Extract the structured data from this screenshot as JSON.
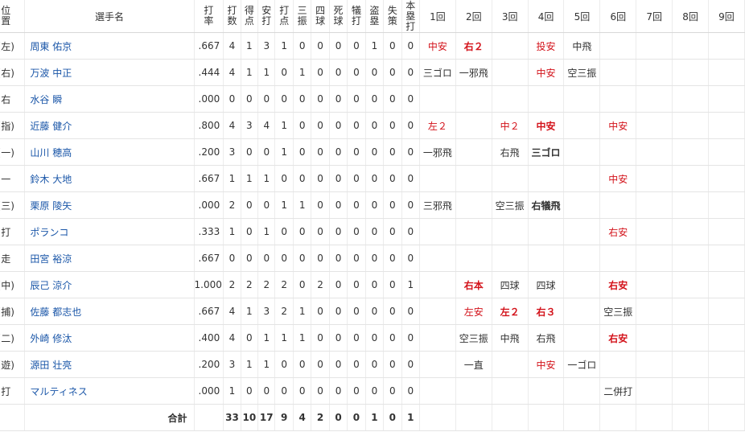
{
  "headers": {
    "position": "位置",
    "player": "選手名",
    "avg": "打率",
    "stats": [
      "打数",
      "得点",
      "安打",
      "打点",
      "三振",
      "四球",
      "死球",
      "犠打",
      "盗塁",
      "失策",
      "本塁打"
    ],
    "innings": [
      "1回",
      "2回",
      "3回",
      "4回",
      "5回",
      "6回",
      "7回",
      "8回",
      "9回"
    ]
  },
  "rows": [
    {
      "pos": "(左)",
      "name": "周東 佑京",
      "avg": ".667",
      "stats": [
        "4",
        "1",
        "3",
        "1",
        "0",
        "0",
        "0",
        "0",
        "1",
        "0",
        "0"
      ],
      "innings": [
        {
          "t": "中安",
          "hit": true,
          "bold": false
        },
        {
          "t": "右２",
          "hit": true,
          "bold": true
        },
        {
          "t": "",
          "hit": false,
          "bold": false
        },
        {
          "t": "投安",
          "hit": true,
          "bold": false
        },
        {
          "t": "中飛",
          "hit": false,
          "bold": false
        },
        {
          "t": "",
          "hit": false,
          "bold": false
        },
        {
          "t": "",
          "hit": false,
          "bold": false
        },
        {
          "t": "",
          "hit": false,
          "bold": false
        },
        {
          "t": "",
          "hit": false,
          "bold": false
        }
      ]
    },
    {
      "pos": "(右)",
      "name": "万波 中正",
      "avg": ".444",
      "stats": [
        "4",
        "1",
        "1",
        "0",
        "1",
        "0",
        "0",
        "0",
        "0",
        "0",
        "0"
      ],
      "innings": [
        {
          "t": "三ゴロ",
          "hit": false,
          "bold": false
        },
        {
          "t": "一邪飛",
          "hit": false,
          "bold": false
        },
        {
          "t": "",
          "hit": false,
          "bold": false
        },
        {
          "t": "中安",
          "hit": true,
          "bold": false
        },
        {
          "t": "空三振",
          "hit": false,
          "bold": false
        },
        {
          "t": "",
          "hit": false,
          "bold": false
        },
        {
          "t": "",
          "hit": false,
          "bold": false
        },
        {
          "t": "",
          "hit": false,
          "bold": false
        },
        {
          "t": "",
          "hit": false,
          "bold": false
        }
      ]
    },
    {
      "pos": "右",
      "name": "水谷 瞬",
      "avg": ".000",
      "stats": [
        "0",
        "0",
        "0",
        "0",
        "0",
        "0",
        "0",
        "0",
        "0",
        "0",
        "0"
      ],
      "innings": [
        {
          "t": "",
          "hit": false,
          "bold": false
        },
        {
          "t": "",
          "hit": false,
          "bold": false
        },
        {
          "t": "",
          "hit": false,
          "bold": false
        },
        {
          "t": "",
          "hit": false,
          "bold": false
        },
        {
          "t": "",
          "hit": false,
          "bold": false
        },
        {
          "t": "",
          "hit": false,
          "bold": false
        },
        {
          "t": "",
          "hit": false,
          "bold": false
        },
        {
          "t": "",
          "hit": false,
          "bold": false
        },
        {
          "t": "",
          "hit": false,
          "bold": false
        }
      ]
    },
    {
      "pos": "(指)",
      "name": "近藤 健介",
      "avg": ".800",
      "stats": [
        "4",
        "3",
        "4",
        "1",
        "0",
        "0",
        "0",
        "0",
        "0",
        "0",
        "0"
      ],
      "innings": [
        {
          "t": "左２",
          "hit": true,
          "bold": false
        },
        {
          "t": "",
          "hit": false,
          "bold": false
        },
        {
          "t": "中２",
          "hit": true,
          "bold": false
        },
        {
          "t": "中安",
          "hit": true,
          "bold": true
        },
        {
          "t": "",
          "hit": false,
          "bold": false
        },
        {
          "t": "中安",
          "hit": true,
          "bold": false
        },
        {
          "t": "",
          "hit": false,
          "bold": false
        },
        {
          "t": "",
          "hit": false,
          "bold": false
        },
        {
          "t": "",
          "hit": false,
          "bold": false
        }
      ]
    },
    {
      "pos": "(一)",
      "name": "山川 穂高",
      "avg": ".200",
      "stats": [
        "3",
        "0",
        "0",
        "1",
        "0",
        "0",
        "0",
        "0",
        "0",
        "0",
        "0"
      ],
      "innings": [
        {
          "t": "一邪飛",
          "hit": false,
          "bold": false
        },
        {
          "t": "",
          "hit": false,
          "bold": false
        },
        {
          "t": "右飛",
          "hit": false,
          "bold": false
        },
        {
          "t": "三ゴロ",
          "hit": false,
          "bold": true
        },
        {
          "t": "",
          "hit": false,
          "bold": false
        },
        {
          "t": "",
          "hit": false,
          "bold": false
        },
        {
          "t": "",
          "hit": false,
          "bold": false
        },
        {
          "t": "",
          "hit": false,
          "bold": false
        },
        {
          "t": "",
          "hit": false,
          "bold": false
        }
      ]
    },
    {
      "pos": "一",
      "name": "鈴木 大地",
      "avg": ".667",
      "stats": [
        "1",
        "1",
        "1",
        "0",
        "0",
        "0",
        "0",
        "0",
        "0",
        "0",
        "0"
      ],
      "innings": [
        {
          "t": "",
          "hit": false,
          "bold": false
        },
        {
          "t": "",
          "hit": false,
          "bold": false
        },
        {
          "t": "",
          "hit": false,
          "bold": false
        },
        {
          "t": "",
          "hit": false,
          "bold": false
        },
        {
          "t": "",
          "hit": false,
          "bold": false
        },
        {
          "t": "中安",
          "hit": true,
          "bold": false
        },
        {
          "t": "",
          "hit": false,
          "bold": false
        },
        {
          "t": "",
          "hit": false,
          "bold": false
        },
        {
          "t": "",
          "hit": false,
          "bold": false
        }
      ]
    },
    {
      "pos": "(三)",
      "name": "栗原 陵矢",
      "avg": ".000",
      "stats": [
        "2",
        "0",
        "0",
        "1",
        "1",
        "0",
        "0",
        "0",
        "0",
        "0",
        "0"
      ],
      "innings": [
        {
          "t": "三邪飛",
          "hit": false,
          "bold": false
        },
        {
          "t": "",
          "hit": false,
          "bold": false
        },
        {
          "t": "空三振",
          "hit": false,
          "bold": false
        },
        {
          "t": "右犠飛",
          "hit": false,
          "bold": true
        },
        {
          "t": "",
          "hit": false,
          "bold": false
        },
        {
          "t": "",
          "hit": false,
          "bold": false
        },
        {
          "t": "",
          "hit": false,
          "bold": false
        },
        {
          "t": "",
          "hit": false,
          "bold": false
        },
        {
          "t": "",
          "hit": false,
          "bold": false
        }
      ]
    },
    {
      "pos": "打",
      "name": "ポランコ",
      "avg": ".333",
      "stats": [
        "1",
        "0",
        "1",
        "0",
        "0",
        "0",
        "0",
        "0",
        "0",
        "0",
        "0"
      ],
      "innings": [
        {
          "t": "",
          "hit": false,
          "bold": false
        },
        {
          "t": "",
          "hit": false,
          "bold": false
        },
        {
          "t": "",
          "hit": false,
          "bold": false
        },
        {
          "t": "",
          "hit": false,
          "bold": false
        },
        {
          "t": "",
          "hit": false,
          "bold": false
        },
        {
          "t": "右安",
          "hit": true,
          "bold": false
        },
        {
          "t": "",
          "hit": false,
          "bold": false
        },
        {
          "t": "",
          "hit": false,
          "bold": false
        },
        {
          "t": "",
          "hit": false,
          "bold": false
        }
      ]
    },
    {
      "pos": "走",
      "name": "田宮 裕涼",
      "avg": ".667",
      "stats": [
        "0",
        "0",
        "0",
        "0",
        "0",
        "0",
        "0",
        "0",
        "0",
        "0",
        "0"
      ],
      "innings": [
        {
          "t": "",
          "hit": false,
          "bold": false
        },
        {
          "t": "",
          "hit": false,
          "bold": false
        },
        {
          "t": "",
          "hit": false,
          "bold": false
        },
        {
          "t": "",
          "hit": false,
          "bold": false
        },
        {
          "t": "",
          "hit": false,
          "bold": false
        },
        {
          "t": "",
          "hit": false,
          "bold": false
        },
        {
          "t": "",
          "hit": false,
          "bold": false
        },
        {
          "t": "",
          "hit": false,
          "bold": false
        },
        {
          "t": "",
          "hit": false,
          "bold": false
        }
      ]
    },
    {
      "pos": "(中)",
      "name": "辰己 涼介",
      "avg": "1.000",
      "stats": [
        "2",
        "2",
        "2",
        "2",
        "0",
        "2",
        "0",
        "0",
        "0",
        "0",
        "1"
      ],
      "innings": [
        {
          "t": "",
          "hit": false,
          "bold": false
        },
        {
          "t": "右本",
          "hit": true,
          "bold": true
        },
        {
          "t": "四球",
          "hit": false,
          "bold": false
        },
        {
          "t": "四球",
          "hit": false,
          "bold": false
        },
        {
          "t": "",
          "hit": false,
          "bold": false
        },
        {
          "t": "右安",
          "hit": true,
          "bold": true
        },
        {
          "t": "",
          "hit": false,
          "bold": false
        },
        {
          "t": "",
          "hit": false,
          "bold": false
        },
        {
          "t": "",
          "hit": false,
          "bold": false
        }
      ]
    },
    {
      "pos": "(捕)",
      "name": "佐藤 都志也",
      "avg": ".667",
      "stats": [
        "4",
        "1",
        "3",
        "2",
        "1",
        "0",
        "0",
        "0",
        "0",
        "0",
        "0"
      ],
      "innings": [
        {
          "t": "",
          "hit": false,
          "bold": false
        },
        {
          "t": "左安",
          "hit": true,
          "bold": false
        },
        {
          "t": "左２",
          "hit": true,
          "bold": true
        },
        {
          "t": "右３",
          "hit": true,
          "bold": true
        },
        {
          "t": "",
          "hit": false,
          "bold": false
        },
        {
          "t": "空三振",
          "hit": false,
          "bold": false
        },
        {
          "t": "",
          "hit": false,
          "bold": false
        },
        {
          "t": "",
          "hit": false,
          "bold": false
        },
        {
          "t": "",
          "hit": false,
          "bold": false
        }
      ]
    },
    {
      "pos": "(二)",
      "name": "外崎 修汰",
      "avg": ".400",
      "stats": [
        "4",
        "0",
        "1",
        "1",
        "1",
        "0",
        "0",
        "0",
        "0",
        "0",
        "0"
      ],
      "innings": [
        {
          "t": "",
          "hit": false,
          "bold": false
        },
        {
          "t": "空三振",
          "hit": false,
          "bold": false
        },
        {
          "t": "中飛",
          "hit": false,
          "bold": false
        },
        {
          "t": "右飛",
          "hit": false,
          "bold": false
        },
        {
          "t": "",
          "hit": false,
          "bold": false
        },
        {
          "t": "右安",
          "hit": true,
          "bold": true
        },
        {
          "t": "",
          "hit": false,
          "bold": false
        },
        {
          "t": "",
          "hit": false,
          "bold": false
        },
        {
          "t": "",
          "hit": false,
          "bold": false
        }
      ]
    },
    {
      "pos": "(遊)",
      "name": "源田 壮亮",
      "avg": ".200",
      "stats": [
        "3",
        "1",
        "1",
        "0",
        "0",
        "0",
        "0",
        "0",
        "0",
        "0",
        "0"
      ],
      "innings": [
        {
          "t": "",
          "hit": false,
          "bold": false
        },
        {
          "t": "一直",
          "hit": false,
          "bold": false
        },
        {
          "t": "",
          "hit": false,
          "bold": false
        },
        {
          "t": "中安",
          "hit": true,
          "bold": false
        },
        {
          "t": "一ゴロ",
          "hit": false,
          "bold": false
        },
        {
          "t": "",
          "hit": false,
          "bold": false
        },
        {
          "t": "",
          "hit": false,
          "bold": false
        },
        {
          "t": "",
          "hit": false,
          "bold": false
        },
        {
          "t": "",
          "hit": false,
          "bold": false
        }
      ]
    },
    {
      "pos": "打",
      "name": "マルティネス",
      "avg": ".000",
      "stats": [
        "1",
        "0",
        "0",
        "0",
        "0",
        "0",
        "0",
        "0",
        "0",
        "0",
        "0"
      ],
      "innings": [
        {
          "t": "",
          "hit": false,
          "bold": false
        },
        {
          "t": "",
          "hit": false,
          "bold": false
        },
        {
          "t": "",
          "hit": false,
          "bold": false
        },
        {
          "t": "",
          "hit": false,
          "bold": false
        },
        {
          "t": "",
          "hit": false,
          "bold": false
        },
        {
          "t": "二併打",
          "hit": false,
          "bold": false
        },
        {
          "t": "",
          "hit": false,
          "bold": false
        },
        {
          "t": "",
          "hit": false,
          "bold": false
        },
        {
          "t": "",
          "hit": false,
          "bold": false
        }
      ]
    }
  ],
  "total": {
    "label": "合計",
    "stats": [
      "33",
      "10",
      "17",
      "9",
      "4",
      "2",
      "0",
      "0",
      "1",
      "0",
      "1"
    ]
  },
  "colors": {
    "hit": "#d3121a",
    "name": "#1a56a8"
  }
}
